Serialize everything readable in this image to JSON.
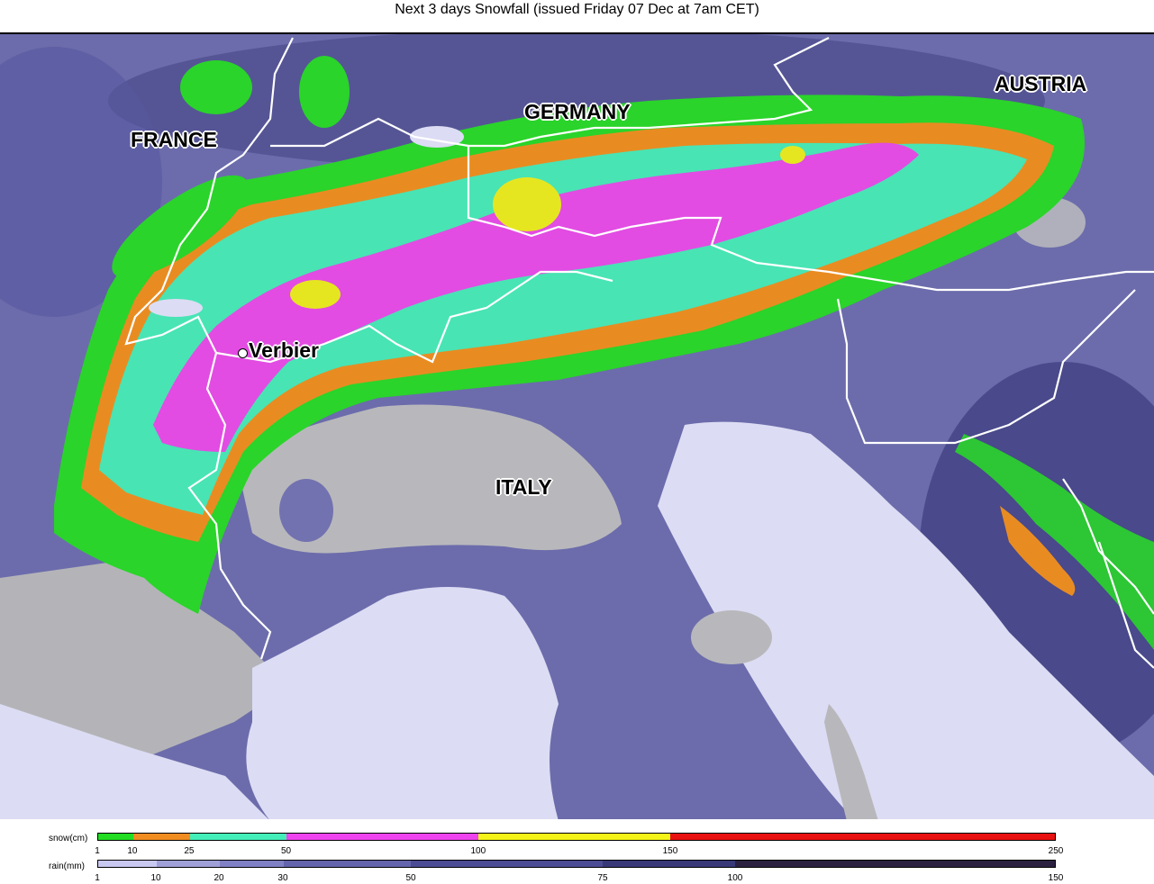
{
  "title": "Next 3 days Snowfall (issued Friday 07 Dec at 7am CET)",
  "map": {
    "countries": [
      {
        "id": "france",
        "label": "FRANCE"
      },
      {
        "id": "germany",
        "label": "GERMANY"
      },
      {
        "id": "austria",
        "label": "AUSTRIA"
      },
      {
        "id": "italy",
        "label": "ITALY"
      }
    ],
    "resort": {
      "label": "Verbier"
    }
  },
  "legend": {
    "snow": {
      "label": "snow(cm)",
      "ticks": [
        "1",
        "10",
        "25",
        "50",
        "100",
        "150",
        "250"
      ],
      "colors": [
        "#22dd22",
        "#f08c20",
        "#44eeb8",
        "#ee44ee",
        "#f4f418",
        "#e81010"
      ]
    },
    "rain": {
      "label": "rain(mm)",
      "ticks": [
        "1",
        "10",
        "20",
        "30",
        "50",
        "75",
        "100",
        "150"
      ],
      "colors": [
        "#c8c8f0",
        "#a0a0d8",
        "#8080c4",
        "#6464ac",
        "#4c4c94",
        "#383878",
        "#2c2040"
      ]
    }
  }
}
